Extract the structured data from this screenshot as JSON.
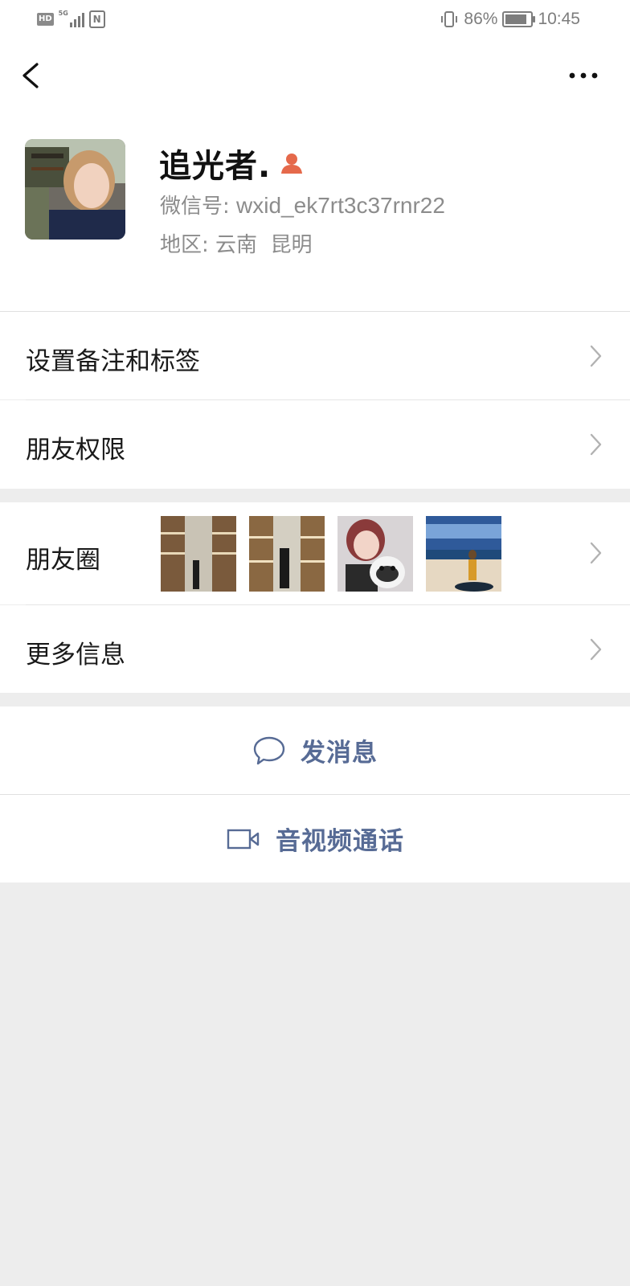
{
  "status_bar": {
    "hd_label": "HD",
    "network_label": "5G",
    "nfc_label": "N",
    "battery_percent_text": "86%",
    "battery_level": 0.86,
    "time": "10:45"
  },
  "nav": {
    "back_icon": "chevron-left-icon",
    "more_icon": "more-dots-icon"
  },
  "profile": {
    "nickname": "追光者.",
    "gender_icon": "female-user-icon",
    "gender_color": "#e5694b",
    "wechat_id_label": "微信号: ",
    "wechat_id_value": "wxid_ek7rt3c37rnr22",
    "region_label": "地区: ",
    "region_value": "云南  昆明"
  },
  "menu": {
    "remark_tags": "设置备注和标签",
    "friend_permissions": "朋友权限",
    "moments": "朋友圈",
    "more_info": "更多信息"
  },
  "actions": {
    "send_message": "发消息",
    "send_message_icon": "chat-bubble-icon",
    "av_call": "音视频通话",
    "av_call_icon": "video-camera-icon",
    "accent_color": "#576b95"
  }
}
